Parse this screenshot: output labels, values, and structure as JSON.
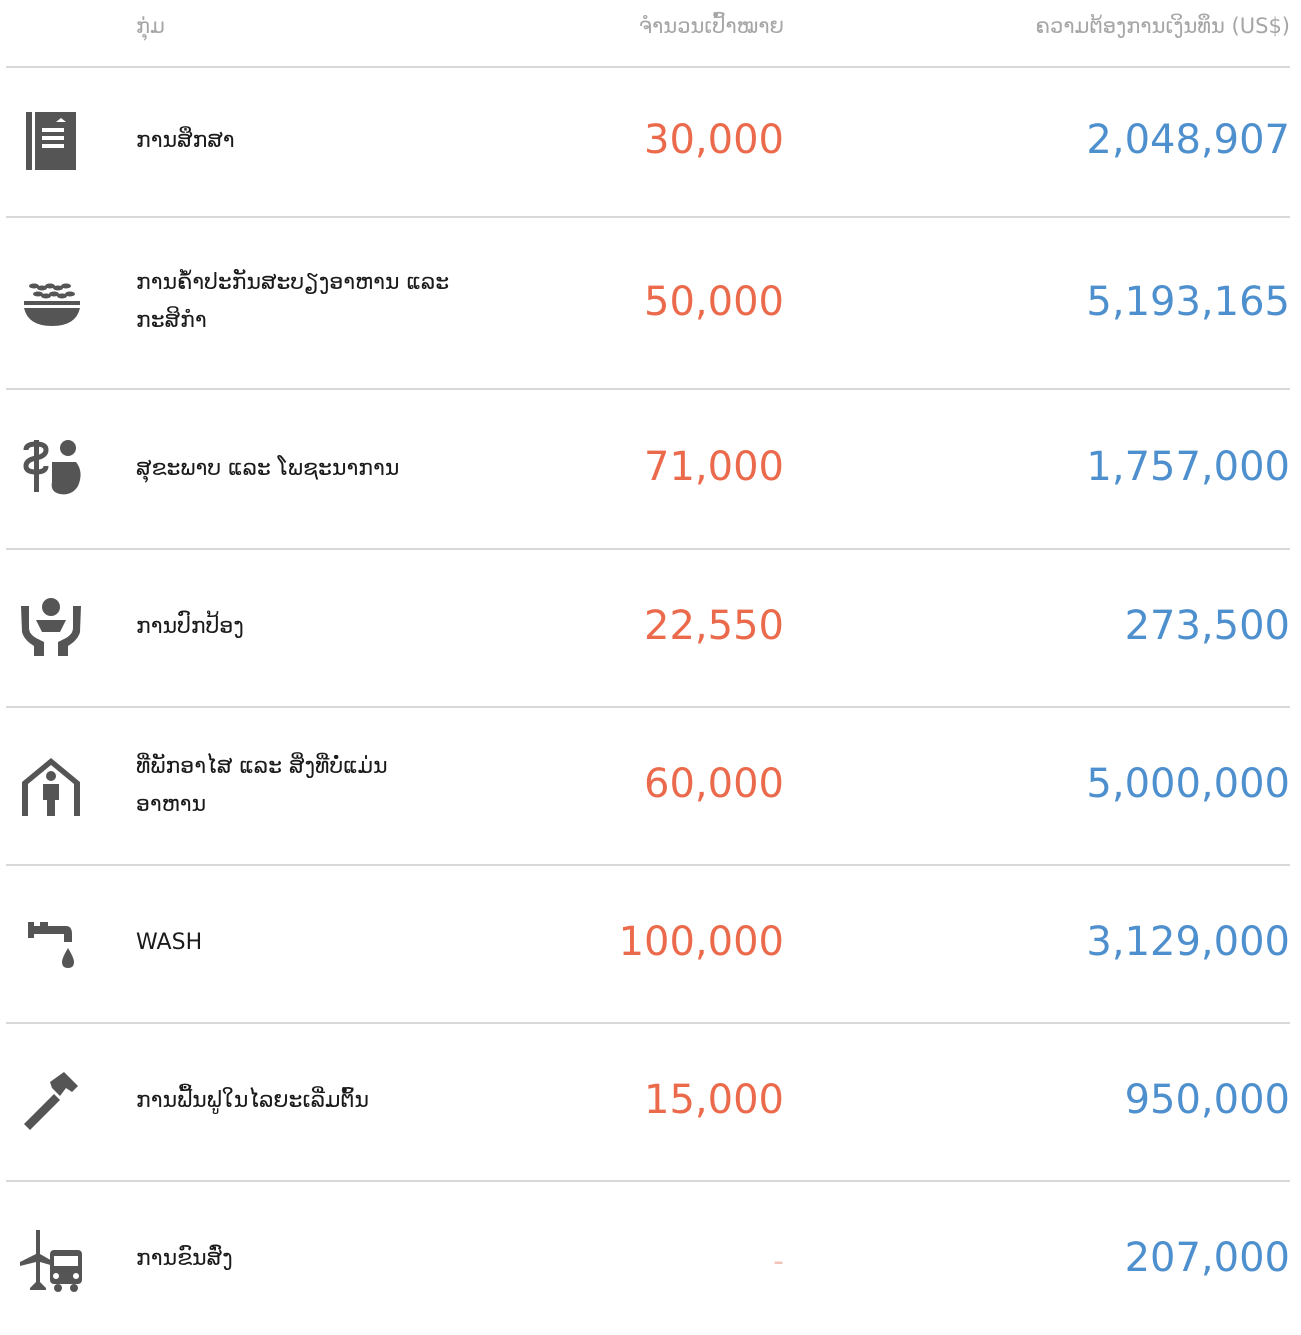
{
  "header": {
    "cluster": "ກຸ່ມ",
    "target": "ຈຳນວນເປົ້າໝາຍ",
    "funding": "ຄວາມຕ້ອງການເງິນທຶນ (US$)"
  },
  "rows": [
    {
      "icon": "education-book-icon",
      "label": "ການສຶກສາ",
      "target": "30,000",
      "funding": "2,048,907"
    },
    {
      "icon": "food-security-bowl-icon",
      "label": "ການຄໍ້າປະກັນສະບຽງອາຫານ ແລະ ກະສິກຳ",
      "target": "50,000",
      "funding": "5,193,165"
    },
    {
      "icon": "health-nutrition-icon",
      "label": "ສຸຂະພາບ ແລະ ໂພຊະນາການ",
      "target": "71,000",
      "funding": "1,757,000"
    },
    {
      "icon": "protection-hands-icon",
      "label": "ການປົກປ້ອງ",
      "target": "22,550",
      "funding": "273,500"
    },
    {
      "icon": "shelter-person-icon",
      "label": "ທີ່ພັກອາໄສ ແລະ ສິ່ງທີ່ບໍ່ແມ່ນອາຫານ",
      "target": "60,000",
      "funding": "5,000,000"
    },
    {
      "icon": "water-tap-icon",
      "label": "WASH",
      "target": "100,000",
      "funding": "3,129,000"
    },
    {
      "icon": "hammer-icon",
      "label": "ການຟື້ນຟູໃນໄລຍະເລີ່ມຕົ້ນ",
      "target": "15,000",
      "funding": "950,000"
    },
    {
      "icon": "logistics-plane-truck-icon",
      "label": "ການຂົນສົ່ງ",
      "target": "-",
      "funding": "207,000"
    }
  ]
}
